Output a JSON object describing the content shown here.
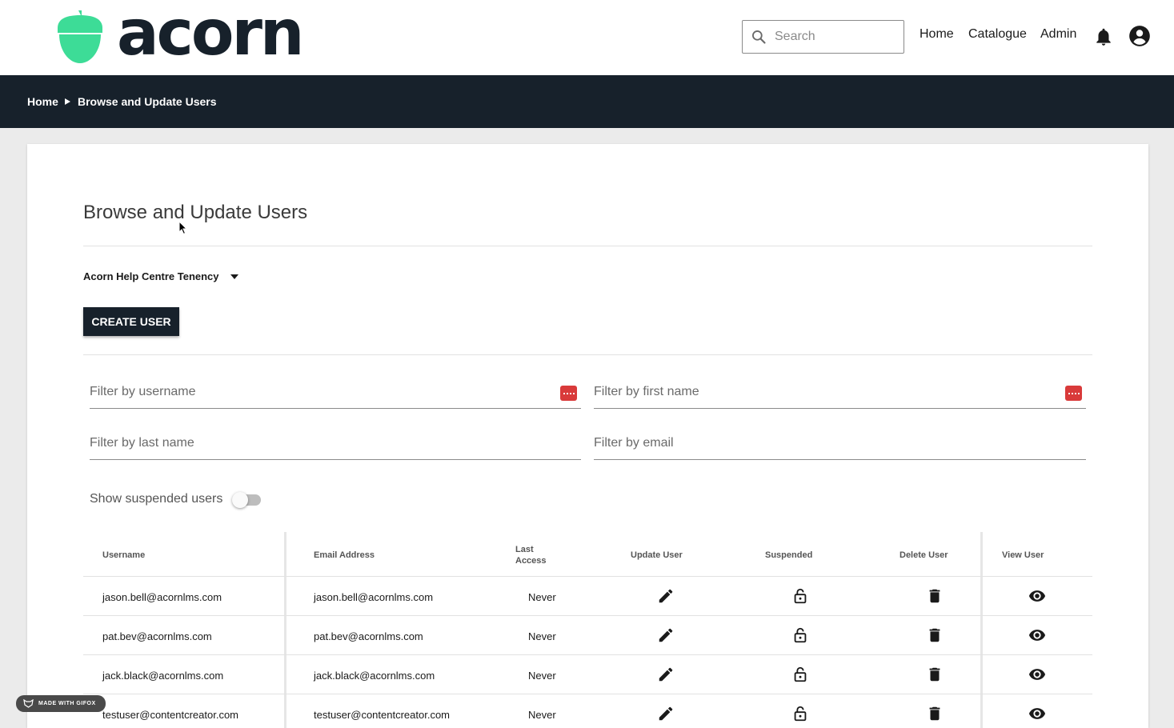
{
  "header": {
    "logo_text": "acorn",
    "search_placeholder": "Search",
    "nav": {
      "home": "Home",
      "catalogue": "Catalogue",
      "admin": "Admin"
    },
    "icons": {
      "bell": "bell-icon",
      "account": "account-circle-icon",
      "search": "search-icon"
    },
    "brand_color": "#3ddc97"
  },
  "breadcrumb": {
    "home": "Home",
    "current": "Browse and Update Users"
  },
  "main": {
    "title": "Browse and Update Users",
    "tenancy": "Acorn Help Centre Tenency",
    "create_button": "CREATE USER",
    "filters": {
      "username": "Filter by username",
      "first_name": "Filter by first name",
      "last_name": "Filter by last name",
      "email": "Filter by email"
    },
    "show_suspended_label": "Show suspended users",
    "show_suspended": false
  },
  "table": {
    "headers": {
      "username": "Username",
      "email": "Email Address",
      "last_access_1": "Last",
      "last_access_2": "Access",
      "update": "Update User",
      "suspended": "Suspended",
      "delete": "Delete User",
      "view": "View User"
    },
    "rows": [
      {
        "username": "jason.bell@acornlms.com",
        "email": "jason.bell@acornlms.com",
        "last_access": "Never"
      },
      {
        "username": "pat.bev@acornlms.com",
        "email": "pat.bev@acornlms.com",
        "last_access": "Never"
      },
      {
        "username": "jack.black@acornlms.com",
        "email": "jack.black@acornlms.com",
        "last_access": "Never"
      },
      {
        "username": "testuser@contentcreator.com",
        "email": "testuser@contentcreator.com",
        "last_access": "Never"
      }
    ]
  },
  "watermark": "MADE WITH GIFOX"
}
